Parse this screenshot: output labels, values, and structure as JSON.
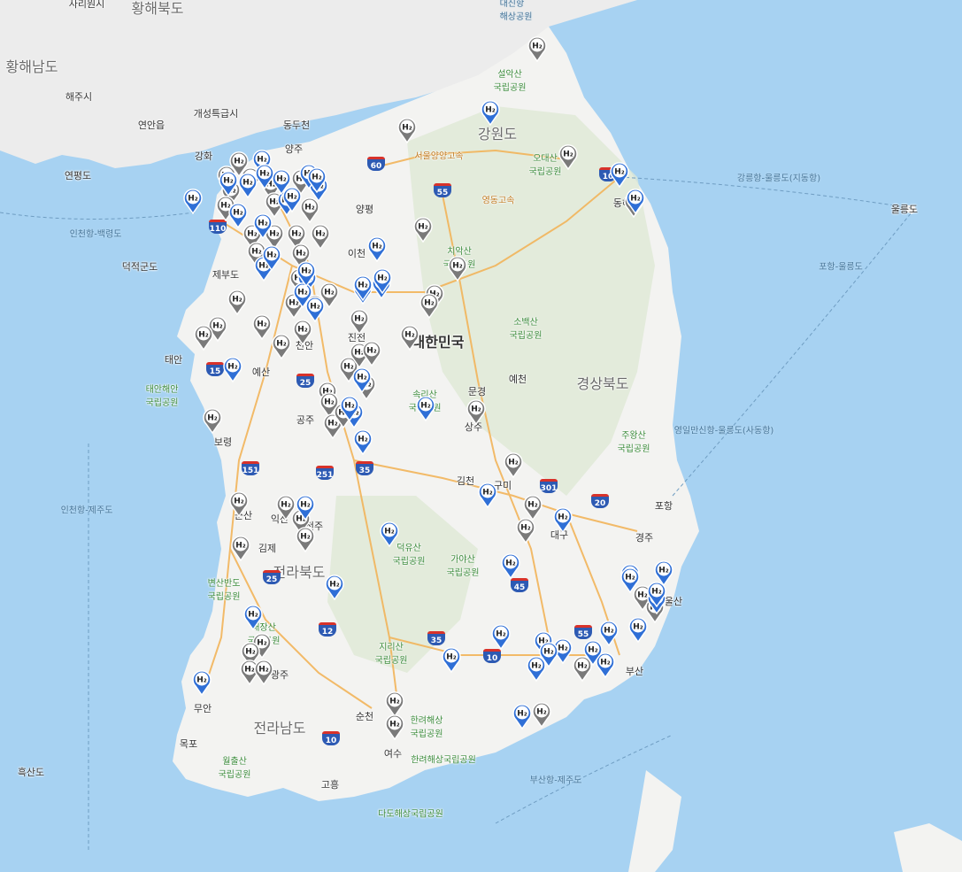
{
  "map": {
    "provinces": [
      "황해북도",
      "황해남도",
      "강원도",
      "경상북도",
      "전라북도",
      "전라남도"
    ],
    "country": "대한민국",
    "cities": [
      "사리원시",
      "해주시",
      "연안읍",
      "개성특급시",
      "동두천",
      "양주",
      "강화",
      "연평도",
      "양평",
      "이천",
      "덕적군도",
      "제부도",
      "예산",
      "태안",
      "천안",
      "진천",
      "보령",
      "공주",
      "문경",
      "예천",
      "상주",
      "김천",
      "구미",
      "대구",
      "포항",
      "경주",
      "울산",
      "부산",
      "군산",
      "익산",
      "전주",
      "김제",
      "광주",
      "무안",
      "목포",
      "순천",
      "여수",
      "고흥",
      "흑산도",
      "울릉도",
      "동해"
    ],
    "parks": [
      "설악산\n국립공원",
      "오대산\n국립공원",
      "치악산\n국립공원",
      "소백산\n국립공원",
      "속리산\n국립공원",
      "주왕산\n국립공원",
      "태안해안\n국립공원",
      "덕유산\n국립공원",
      "가야산\n국립공원",
      "변산반도\n국립공원",
      "내장산\n국립공원",
      "지리산\n국립공원",
      "월출산\n국립공원",
      "한려해상\n국립공원",
      "한려해상국립공원",
      "다도해상국립공원"
    ],
    "sea_routes": [
      "강릉항-울릉도(지동항)",
      "인천항-백령도",
      "인천항-제주도",
      "영일만신항-울릉도(사동항)",
      "포항-울릉도",
      "부산항-제주도",
      "대진항\n해상공원"
    ],
    "roads": [
      "서울양양고속",
      "영동고속"
    ],
    "highways": [
      "60",
      "55",
      "110",
      "15",
      "25",
      "251",
      "151",
      "35",
      "301",
      "20",
      "55",
      "45",
      "25",
      "12",
      "10",
      "35",
      "10",
      "10"
    ],
    "station_glyph": "H₂",
    "station_counts": {
      "blue": 57,
      "gray": 63
    }
  }
}
